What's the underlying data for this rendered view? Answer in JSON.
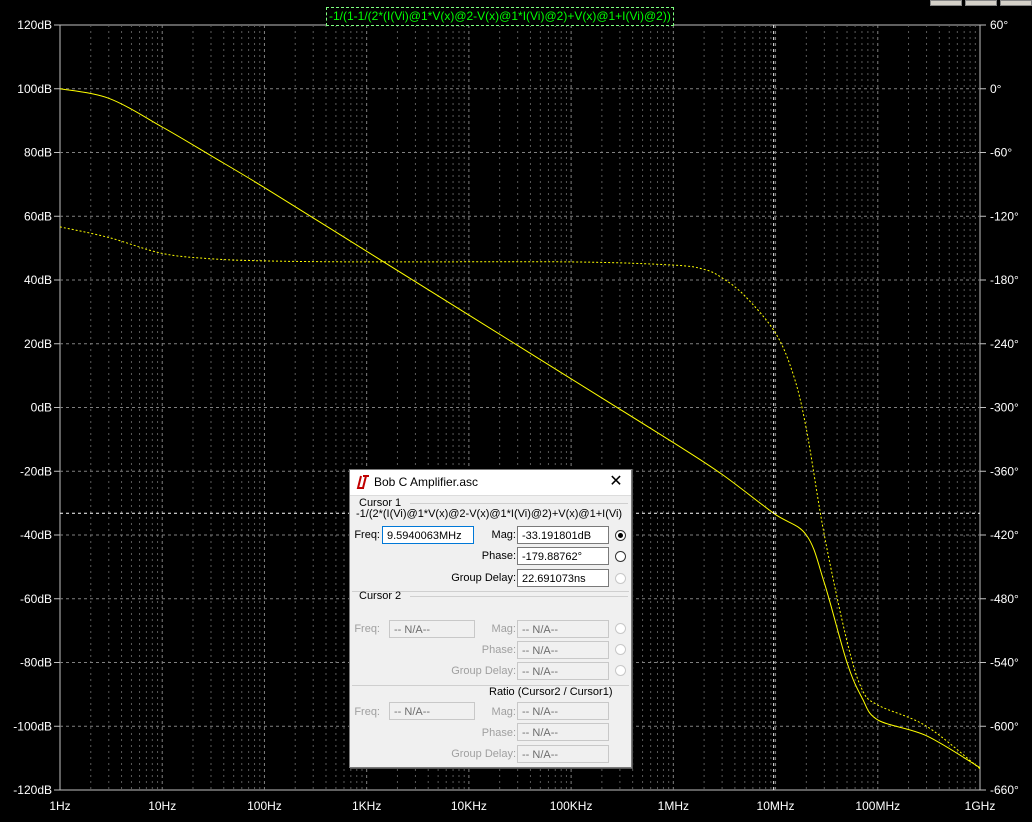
{
  "trace_expression": "-1/(1-1/(2*(I(Vi)@1*V(x)@2-V(x)@1*I(Vi)@2)+V(x)@1+I(Vi)@2))",
  "chart_data": {
    "type": "line",
    "title": "-1/(1-1/(2*(I(Vi)@1*V(x)@2-V(x)@1*I(Vi)@2)+V(x)@1+I(Vi)@2))",
    "x_scale": "log",
    "xlim": [
      1,
      1000000000
    ],
    "x_tick_labels": [
      "1Hz",
      "10Hz",
      "100Hz",
      "1KHz",
      "10KHz",
      "100KHz",
      "1MHz",
      "10MHz",
      "100MHz",
      "1GHz"
    ],
    "ylim_left_db": [
      -120,
      120
    ],
    "y_tick_labels_left": [
      "120dB",
      "100dB",
      "80dB",
      "60dB",
      "40dB",
      "20dB",
      "0dB",
      "-20dB",
      "-40dB",
      "-60dB",
      "-80dB",
      "-100dB",
      "-120dB"
    ],
    "ylim_right_deg": [
      -660,
      60
    ],
    "y_tick_labels_right": [
      "60°",
      "0°",
      "-60°",
      "-120°",
      "-180°",
      "-240°",
      "-300°",
      "-360°",
      "-420°",
      "-480°",
      "-540°",
      "-600°",
      "-660°"
    ],
    "grid": true,
    "colors": {
      "background": "#000000",
      "trace": "#ffff00",
      "grid": "#808080",
      "label": "#00ff00"
    },
    "cursor": {
      "freq_hz": 9594006.3,
      "mag_db": -33.19
    },
    "series": [
      {
        "kind": "magnitude_db",
        "style": "solid",
        "x": [
          1,
          3,
          10,
          30,
          100,
          1000,
          10000,
          100000,
          1000000,
          3000000,
          9594006,
          20000000,
          30000000,
          50000000,
          70000000,
          100000000,
          300000000,
          1000000000
        ],
        "y": [
          100,
          97,
          88,
          79,
          69,
          49,
          29,
          9,
          -11,
          -21,
          -33.2,
          -40,
          -55,
          -80,
          -91,
          -98,
          -103,
          -113
        ]
      },
      {
        "kind": "phase_deg",
        "style": "dashed",
        "x": [
          1,
          3,
          10,
          30,
          100,
          1000,
          100000,
          1000000,
          2000000,
          3000000,
          5000000,
          10000000,
          15000000,
          20000000,
          30000000,
          50000000,
          70000000,
          100000000,
          300000000,
          1000000000
        ],
        "y": [
          -130,
          -140,
          -155,
          -160,
          -162,
          -163,
          -163,
          -166,
          -170,
          -178,
          -195,
          -230,
          -270,
          -320,
          -420,
          -520,
          -565,
          -580,
          -600,
          -640
        ]
      }
    ]
  },
  "dialog": {
    "title": "Bob C Amplifier.asc",
    "close_glyph": "✕",
    "cursor1": {
      "label": "Cursor 1",
      "expr": "-1/(2*(I(Vi)@1*V(x)@2-V(x)@1*I(Vi)@2)+V(x)@1+I(Vi)",
      "freq_label": "Freq:",
      "freq": "9.5940063MHz",
      "mag_label": "Mag:",
      "mag": "-33.191801dB",
      "phase_label": "Phase:",
      "phase": "-179.88762°",
      "gd_label": "Group Delay:",
      "gd": "22.691073ns"
    },
    "cursor2": {
      "label": "Cursor 2",
      "freq_label": "Freq:",
      "freq": "-- N/A--",
      "mag_label": "Mag:",
      "mag": "-- N/A--",
      "phase_label": "Phase:",
      "phase": "-- N/A--",
      "gd_label": "Group Delay:",
      "gd": "-- N/A--"
    },
    "ratio": {
      "label": "Ratio (Cursor2 / Cursor1)",
      "freq_label": "Freq:",
      "freq": "-- N/A--",
      "mag_label": "Mag:",
      "mag": "-- N/A--",
      "phase_label": "Phase:",
      "phase": "-- N/A--",
      "gd_label": "Group Delay:",
      "gd": "-- N/A--"
    }
  }
}
